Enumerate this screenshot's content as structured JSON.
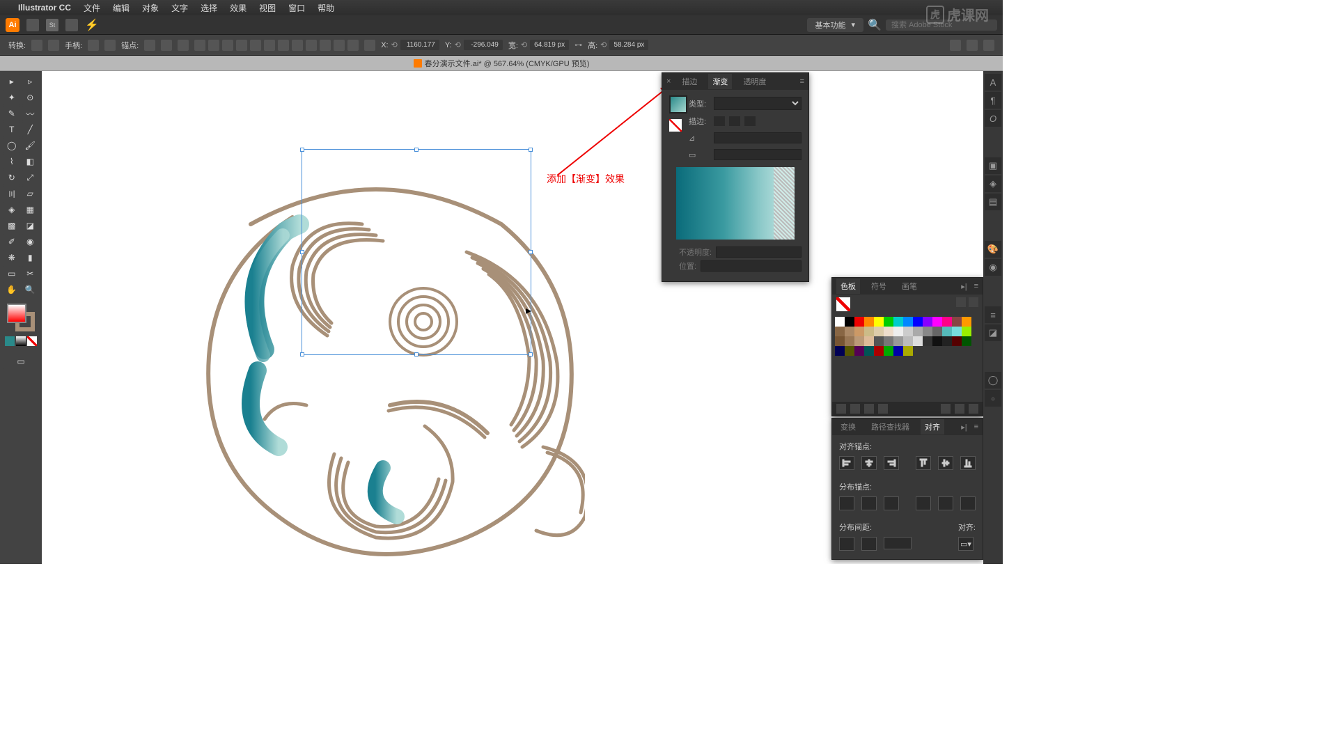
{
  "menubar": {
    "app": "Illustrator CC",
    "items": [
      "文件",
      "编辑",
      "对象",
      "文字",
      "选择",
      "效果",
      "视图",
      "窗口",
      "帮助"
    ]
  },
  "appbar": {
    "workspace": "基本功能",
    "search_ph": "搜索 Adobe Stock"
  },
  "ctrlbar": {
    "transform": "转换:",
    "handle": "手柄:",
    "anchor": "锚点:",
    "x_lbl": "X:",
    "x_val": "1160.177",
    "y_lbl": "Y:",
    "y_val": "-296.049",
    "w_lbl": "宽:",
    "w_val": "64.819 px",
    "h_lbl": "高:",
    "h_val": "58.284 px"
  },
  "document": {
    "title": "春分演示文件.ai* @ 567.64% (CMYK/GPU 预览)"
  },
  "annot": "添加【渐变】效果",
  "grad": {
    "tabs": [
      "描边",
      "渐变",
      "透明度"
    ],
    "type_lbl": "类型:",
    "stroke_lbl": "描边:",
    "opacity_lbl": "不透明度:",
    "pos_lbl": "位置:"
  },
  "swatch": {
    "tabs": [
      "色板",
      "符号",
      "画笔"
    ]
  },
  "align": {
    "tabs": [
      "变换",
      "路径查找器",
      "对齐"
    ],
    "sect1": "对齐锚点:",
    "sect2": "分布锚点:",
    "sect3": "分布间距:",
    "sect3r": "对齐:"
  },
  "watermark": "虎课网"
}
